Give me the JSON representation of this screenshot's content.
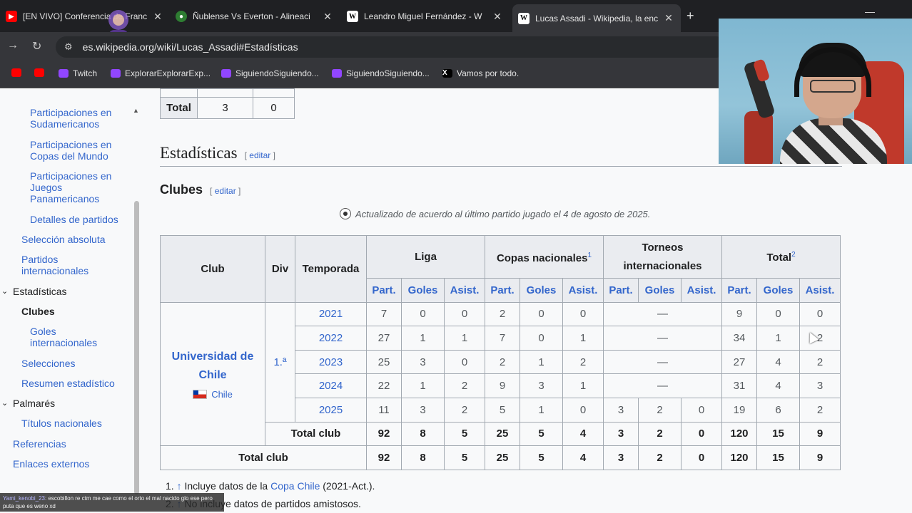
{
  "browser": {
    "tabs": [
      {
        "label": "[EN VIVO] Conferencia de Franc",
        "icon": "youtube-icon"
      },
      {
        "label": "Ñublense Vs Everton - Alineaci",
        "icon": "globe-icon"
      },
      {
        "label": "Leandro Miguel Fernández - W",
        "icon": "wikipedia-icon"
      },
      {
        "label": "Lucas Assadi - Wikipedia, la enc",
        "icon": "wikipedia-icon"
      }
    ],
    "url": "es.wikipedia.org/wiki/Lucas_Assadi#Estadísticas",
    "bookmarks": [
      {
        "label": "",
        "icon": "youtube-icon"
      },
      {
        "label": "",
        "icon": "youtube-icon"
      },
      {
        "label": "Twitch",
        "icon": "twitch-icon"
      },
      {
        "label": "ExplorarExplorarExp...",
        "icon": "twitch-icon"
      },
      {
        "label": "SiguiendoSiguiendo...",
        "icon": "twitch-icon"
      },
      {
        "label": "SiguiendoSiguiendo...",
        "icon": "twitch-icon"
      },
      {
        "label": "Vamos por todo.",
        "icon": "x-icon"
      }
    ]
  },
  "toc": [
    {
      "label": "Participaciones en Sudamericanos",
      "type": "sub2"
    },
    {
      "label": "Participaciones en Copas del Mundo",
      "type": "sub2"
    },
    {
      "label": "Participaciones en Juegos Panamericanos",
      "type": "sub2"
    },
    {
      "label": "Detalles de partidos",
      "type": "sub2"
    },
    {
      "label": "Selección absoluta",
      "type": "sub1"
    },
    {
      "label": "Partidos internacionales",
      "type": "sub1"
    },
    {
      "label": "Estadísticas",
      "type": "head"
    },
    {
      "label": "Clubes",
      "type": "current"
    },
    {
      "label": "Goles internacionales",
      "type": "sub2"
    },
    {
      "label": "Selecciones",
      "type": "sub1"
    },
    {
      "label": "Resumen estadístico",
      "type": "sub1"
    },
    {
      "label": "Palmarés",
      "type": "head"
    },
    {
      "label": "Títulos nacionales",
      "type": "sub1"
    },
    {
      "label": "Referencias",
      "type": "top"
    },
    {
      "label": "Enlaces externos",
      "type": "top"
    }
  ],
  "top_table": {
    "label": "Total",
    "values": [
      "3",
      "0"
    ]
  },
  "section": {
    "title": "Estadísticas",
    "edit": "editar"
  },
  "subsection": {
    "title": "Clubes",
    "edit": "editar"
  },
  "note": "Actualizado de acuerdo al último partido jugado el 4 de agosto de 2025.",
  "stats": {
    "headers": {
      "club": "Club",
      "div": "Div",
      "temporada": "Temporada",
      "liga": "Liga",
      "copas": "Copas nacionales",
      "copas_ref": "1",
      "torneos": "Torneos internacionales",
      "total": "Total",
      "total_ref": "2"
    },
    "subheaders": [
      "Part.",
      "Goles",
      "Asist.",
      "Part.",
      "Goles",
      "Asist.",
      "Part.",
      "Goles",
      "Asist.",
      "Part.",
      "Goles",
      "Asist."
    ],
    "club": "Universidad de Chile",
    "country": "Chile",
    "division": "1.ª",
    "dash": "—",
    "rows": [
      {
        "season": "2021",
        "liga": [
          "7",
          "0",
          "0"
        ],
        "copas": [
          "2",
          "0",
          "0"
        ],
        "torneos": null,
        "total": [
          "9",
          "0",
          "0"
        ]
      },
      {
        "season": "2022",
        "liga": [
          "27",
          "1",
          "1"
        ],
        "copas": [
          "7",
          "0",
          "1"
        ],
        "torneos": null,
        "total": [
          "34",
          "1",
          "2"
        ]
      },
      {
        "season": "2023",
        "liga": [
          "25",
          "3",
          "0"
        ],
        "copas": [
          "2",
          "1",
          "2"
        ],
        "torneos": null,
        "total": [
          "27",
          "4",
          "2"
        ]
      },
      {
        "season": "2024",
        "liga": [
          "22",
          "1",
          "2"
        ],
        "copas": [
          "9",
          "3",
          "1"
        ],
        "torneos": null,
        "total": [
          "31",
          "4",
          "3"
        ]
      },
      {
        "season": "2025",
        "liga": [
          "11",
          "3",
          "2"
        ],
        "copas": [
          "5",
          "1",
          "0"
        ],
        "torneos": [
          "3",
          "2",
          "0"
        ],
        "total": [
          "19",
          "6",
          "2"
        ]
      }
    ],
    "total_club_label": "Total club",
    "total_club": [
      "92",
      "8",
      "5",
      "25",
      "5",
      "4",
      "3",
      "2",
      "0",
      "120",
      "15",
      "9"
    ],
    "total_all_label": "Total club",
    "total_all": [
      "92",
      "8",
      "5",
      "25",
      "5",
      "4",
      "3",
      "2",
      "0",
      "120",
      "15",
      "9"
    ]
  },
  "refs": [
    {
      "num": "1.",
      "arrow": "↑",
      "pre": "Incluye datos de la",
      "link": "Copa Chile",
      "post": "(2021-Act.)."
    },
    {
      "num": "2.",
      "arrow": "↑",
      "pre": "No incluye datos de partidos amistosos.",
      "link": "",
      "post": ""
    }
  ],
  "chat": {
    "user": "Yami_kenobi_23",
    "message": ": escobillon re ctm me cae como el orto el mal nacido glo ese pero puta que es weno xd"
  }
}
